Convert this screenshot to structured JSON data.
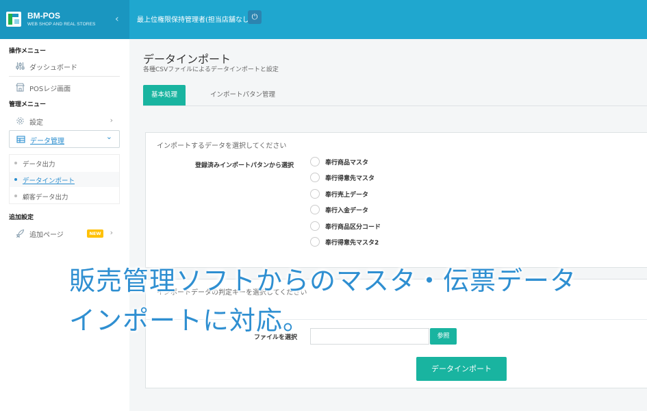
{
  "header": {
    "brand_name": "BM-POS",
    "brand_sub": "WEB SHOP AND REAL STORES",
    "collapse_icon": "‹",
    "user_label": "最上位権限保持管理者(担当店舗なし)",
    "power_icon": "⏻"
  },
  "sidebar": {
    "section_operation": "操作メニュー",
    "dashboard": "ダッシュボード",
    "pos_screen": "POSレジ画面",
    "section_admin": "管理メニュー",
    "settings": "設定",
    "data_management": "データ管理",
    "submenu": [
      "データ出力",
      "データインポート",
      "顧客データ出力"
    ],
    "section_additional": "追加設定",
    "additional_page": "追加ページ",
    "new_badge": "NEW",
    "chevron_right": "›",
    "chevron_down": "⌄"
  },
  "main": {
    "title": "データインポート",
    "subtitle": "各種CSVファイルによるデータインポートと設定",
    "tabs": [
      "基本処理",
      "インポートパタン管理"
    ],
    "panel1": {
      "title": "インポートするデータを選択してください",
      "field_label": "登録済みインポートパタンから選択",
      "options": [
        "奉行商品マスタ",
        "奉行得意先マスタ",
        "奉行売上データ",
        "奉行入金データ",
        "奉行商品区分コード",
        "奉行得意先マスタ2"
      ]
    },
    "panel2": {
      "title": "インポートデータの判定キーを選択してください",
      "file_label": "ファイルを選択",
      "browse_button": "参照",
      "import_button": "データインポート"
    }
  },
  "overlay": {
    "line1": "販売管理ソフトからのマスタ・伝票データ",
    "line2": "インポートに対応。"
  },
  "colors": {
    "header": "#1fa7cf",
    "accent_teal": "#19b4a0",
    "link_blue": "#2b8ecf",
    "overlay_text": "#2f8fd1"
  }
}
